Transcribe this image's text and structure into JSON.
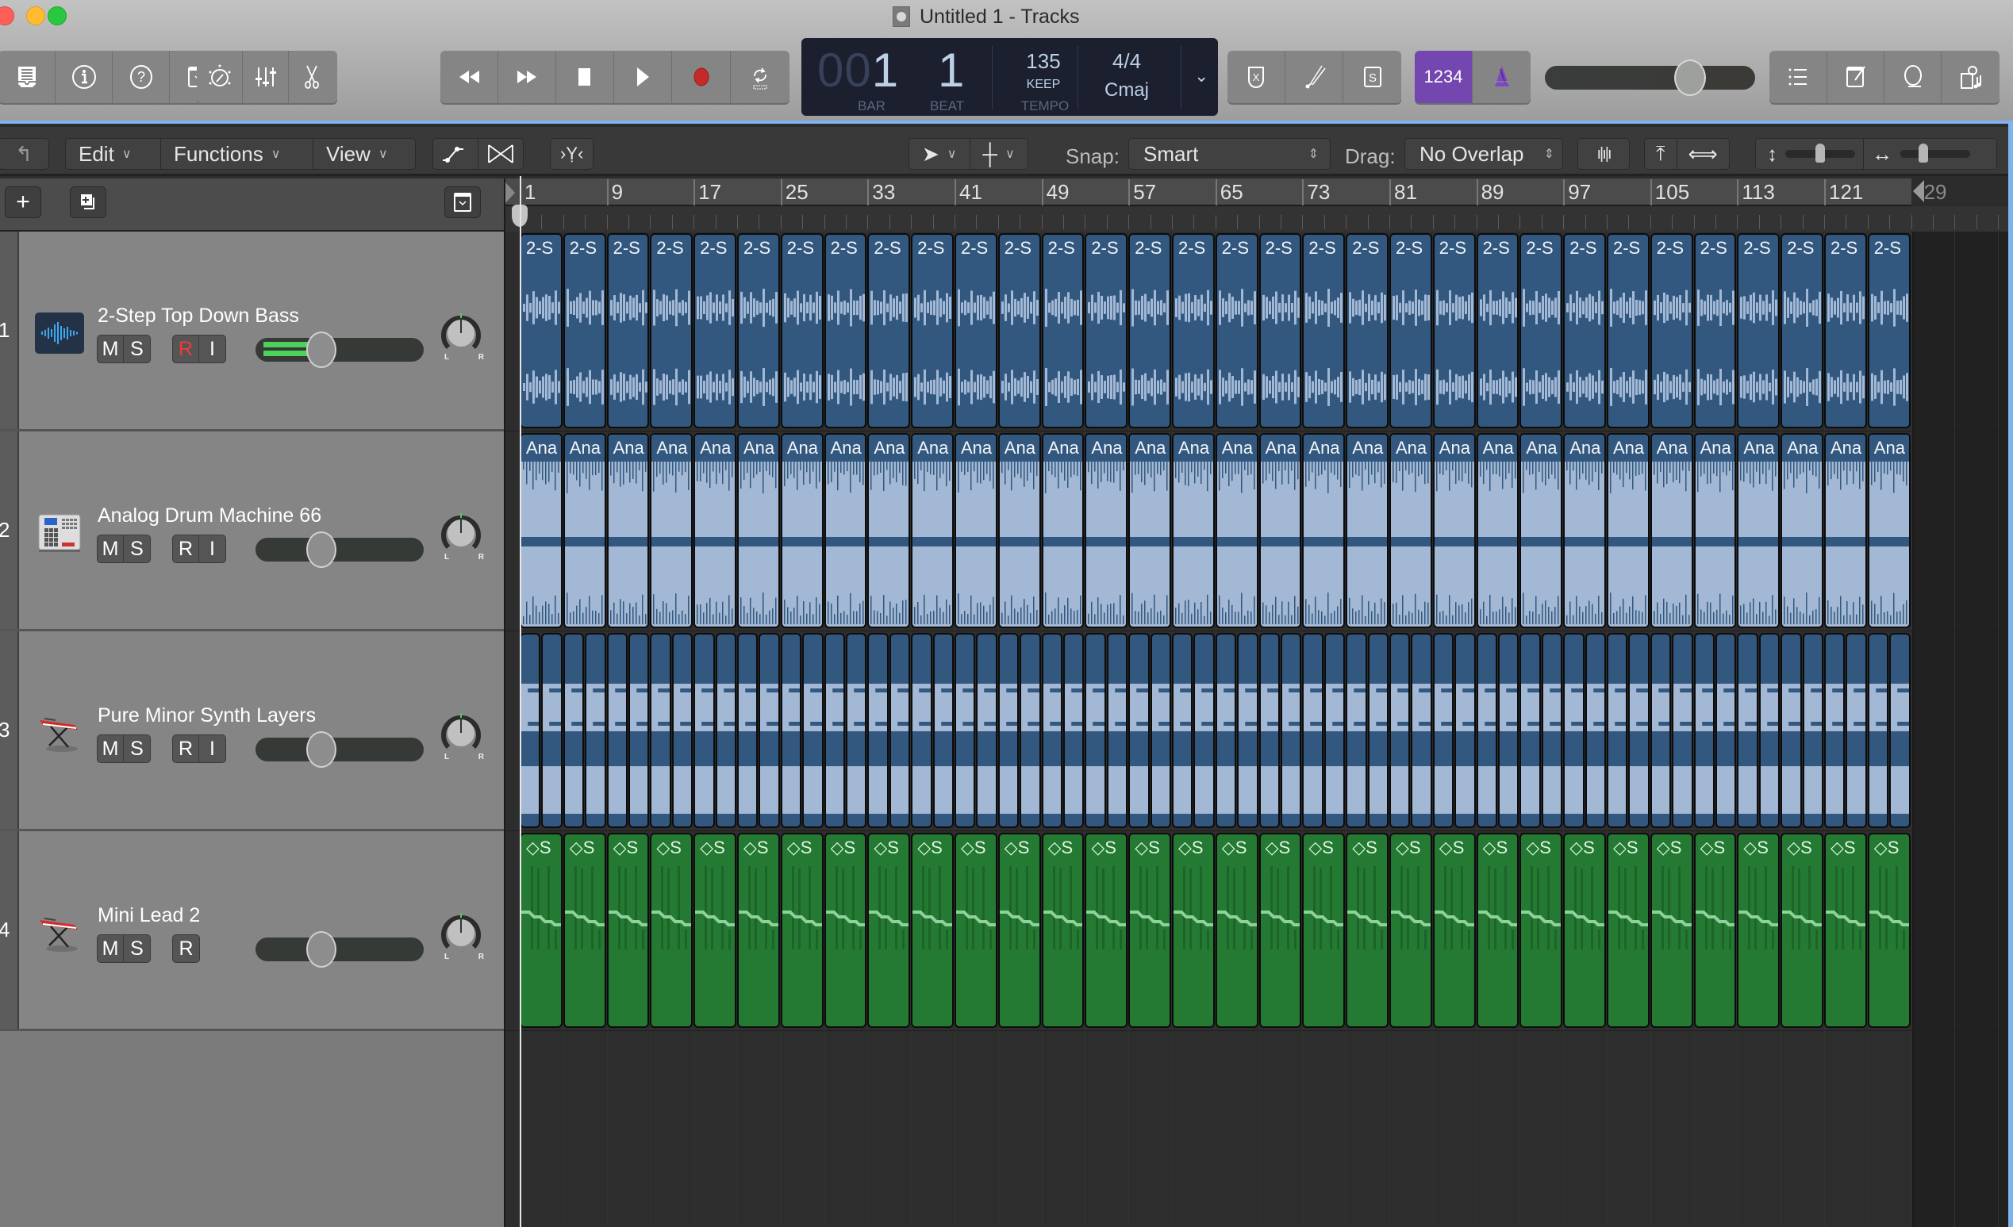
{
  "window": {
    "title": "Untitled 1 - Tracks"
  },
  "toolbar": {
    "left_group": [
      "library-icon",
      "inspector-icon",
      "quick-help-icon",
      "toolbar-icon"
    ],
    "mid_group": [
      "smart-controls-icon",
      "mixer-icon",
      "editors-icon"
    ],
    "transport": [
      "rewind-icon",
      "fast-forward-icon",
      "stop-icon",
      "play-icon",
      "record-icon",
      "cycle-icon"
    ]
  },
  "lcd": {
    "bar_dim": "00",
    "bar": "1",
    "beat": "1",
    "bar_label": "BAR",
    "beat_label": "BEAT",
    "tempo": "135",
    "tempo_mode": "KEEP",
    "tempo_label": "TEMPO",
    "time_signature": "4/4",
    "key": "Cmaj"
  },
  "right_toolbar": {
    "count_in_label": "1234",
    "count_in_active": true,
    "master_volume": 0.7,
    "accent_color": "#7447b0"
  },
  "secondary_toolbar": {
    "menus": [
      {
        "label": "Edit"
      },
      {
        "label": "Functions"
      },
      {
        "label": "View"
      }
    ],
    "snap_label": "Snap:",
    "snap_value": "Smart",
    "drag_label": "Drag:",
    "drag_value": "No Overlap",
    "vertical_zoom": 0.5,
    "horizontal_zoom": 0.3
  },
  "ruler": {
    "labels": [
      "1",
      "9",
      "17",
      "25",
      "33",
      "41",
      "49",
      "57",
      "65",
      "73",
      "81",
      "89",
      "97",
      "105",
      "113",
      "121"
    ],
    "end_label": "129"
  },
  "tracks": [
    {
      "number": "1",
      "name": "2-Step Top Down Bass",
      "icon": "audio-waveform-icon",
      "buttons": [
        "M",
        "S",
        "R",
        "I"
      ],
      "record_armed": true,
      "meter_active": true,
      "volume": 0.5,
      "pan": 0,
      "region_label": "2-S",
      "region_type": "audio",
      "region_count": 32
    },
    {
      "number": "2",
      "name": "Analog Drum Machine 66",
      "icon": "drum-machine-icon",
      "buttons": [
        "M",
        "S",
        "R",
        "I"
      ],
      "record_armed": false,
      "meter_active": false,
      "volume": 0.5,
      "pan": 0,
      "region_label": "Ana",
      "region_type": "drum",
      "region_count": 32
    },
    {
      "number": "3",
      "name": "Pure Minor Synth Layers",
      "icon": "keyboard-icon",
      "buttons": [
        "M",
        "S",
        "R",
        "I"
      ],
      "record_armed": false,
      "meter_active": false,
      "volume": 0.5,
      "pan": 0,
      "region_label": "",
      "region_type": "synth",
      "region_count": 64
    },
    {
      "number": "4",
      "name": "Mini Lead 2",
      "icon": "keyboard-icon",
      "buttons": [
        "M",
        "S",
        "R"
      ],
      "record_armed": false,
      "meter_active": false,
      "volume": 0.5,
      "pan": 0,
      "region_label": "◇S",
      "region_type": "midi",
      "region_count": 32
    }
  ]
}
